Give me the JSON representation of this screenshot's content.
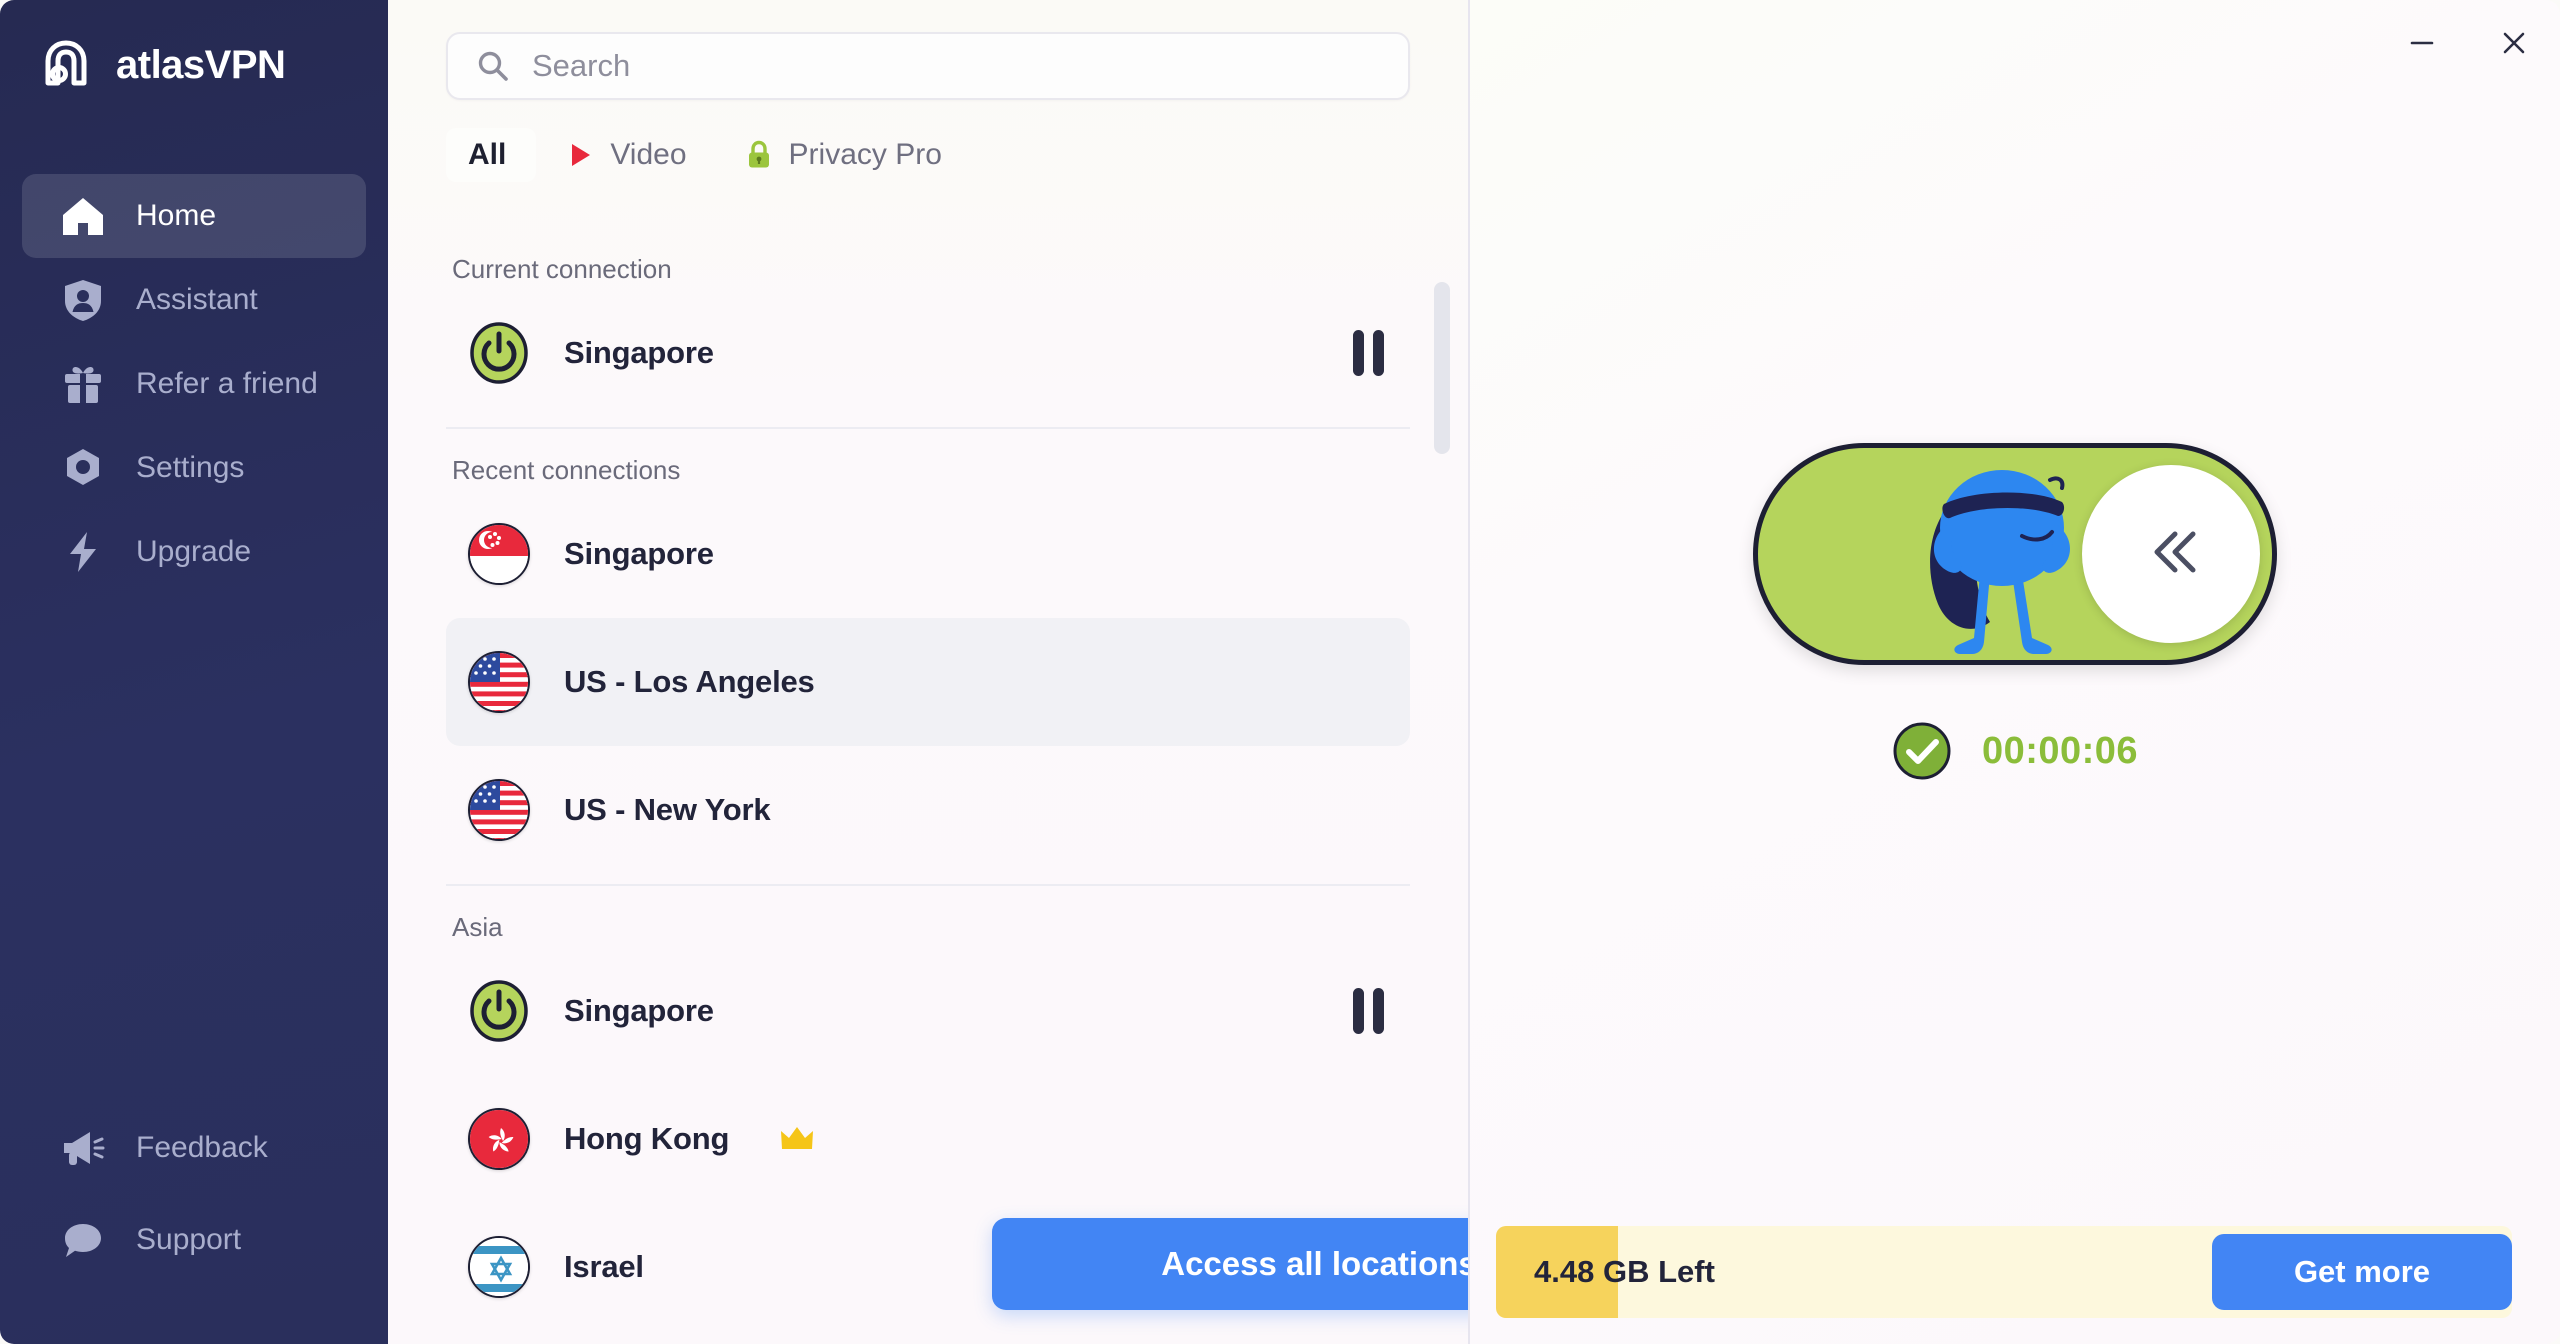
{
  "app": {
    "brand_name": "atlasVPN",
    "logo_icon": "atlas-logo-icon"
  },
  "sidebar": {
    "top_items": [
      {
        "label": "Home",
        "icon": "home-icon",
        "active": true
      },
      {
        "label": "Assistant",
        "icon": "shield-person-icon",
        "active": false
      },
      {
        "label": "Refer a friend",
        "icon": "gift-icon",
        "active": false
      },
      {
        "label": "Settings",
        "icon": "gear-nut-icon",
        "active": false
      },
      {
        "label": "Upgrade",
        "icon": "lightning-bolt-icon",
        "active": false
      }
    ],
    "bottom_items": [
      {
        "label": "Feedback",
        "icon": "megaphone-icon"
      },
      {
        "label": "Support",
        "icon": "chat-bubble-icon"
      }
    ]
  },
  "search": {
    "placeholder": "Search",
    "value": "",
    "icon": "search-icon"
  },
  "tabs": [
    {
      "label": "All",
      "icon": null,
      "active": true
    },
    {
      "label": "Video",
      "icon": "play-triangle-icon",
      "active": false
    },
    {
      "label": "Privacy Pro",
      "icon": "green-lock-icon",
      "active": false
    }
  ],
  "sections": [
    {
      "label": "Current connection",
      "rows": [
        {
          "name": "Singapore",
          "icon": "power-on-icon",
          "flag": null,
          "connected": true,
          "premium": false,
          "hovered": false,
          "pause": true
        }
      ]
    },
    {
      "label": "Recent connections",
      "rows": [
        {
          "name": "Singapore",
          "icon": null,
          "flag": "flag-singapore",
          "connected": false,
          "premium": false,
          "hovered": false,
          "pause": false
        },
        {
          "name": "US - Los Angeles",
          "icon": null,
          "flag": "flag-usa",
          "connected": false,
          "premium": false,
          "hovered": true,
          "pause": false
        },
        {
          "name": "US - New York",
          "icon": null,
          "flag": "flag-usa",
          "connected": false,
          "premium": false,
          "hovered": false,
          "pause": false
        }
      ]
    },
    {
      "label": "Asia",
      "rows": [
        {
          "name": "Singapore",
          "icon": "power-on-icon",
          "flag": null,
          "connected": true,
          "premium": false,
          "hovered": false,
          "pause": true
        },
        {
          "name": "Hong Kong",
          "icon": null,
          "flag": "flag-hongkong",
          "connected": false,
          "premium": true,
          "hovered": false,
          "pause": false
        },
        {
          "name": "Israel",
          "icon": null,
          "flag": "flag-israel",
          "connected": false,
          "premium": false,
          "hovered": false,
          "pause": false
        }
      ]
    }
  ],
  "access_button": {
    "label": "Access all locations"
  },
  "window_controls": {
    "minimize_icon": "minimize-icon",
    "close_icon": "close-icon"
  },
  "connection_panel": {
    "toggle_state": "on",
    "mascot_icon": "superhero-mascot-icon",
    "knob_icon": "double-chevron-left-icon",
    "status_icon": "check-circle-icon",
    "timer": "00:00:06"
  },
  "data_meter": {
    "amount": "4.48",
    "unit_label": " GB Left",
    "get_more_label": "Get more",
    "fill_percent": 12
  },
  "colors": {
    "sidebar_bg": "#2a2f5c",
    "accent_blue": "#4285f4",
    "toggle_green": "#b5d45c",
    "timer_green": "#8bbd3a",
    "meter_yellow": "#f6d35c",
    "meter_track": "#fdf8dd",
    "text_dark": "#22243a"
  }
}
